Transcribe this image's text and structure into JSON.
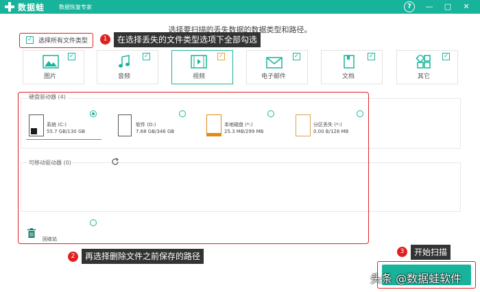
{
  "app": {
    "name": "数据蛙",
    "subtitle": "数据恢复专家",
    "controls": {
      "help": "?",
      "minimize": "—",
      "maximize": "□",
      "close": "✕"
    }
  },
  "colors": {
    "accent": "#17b39a",
    "annotation": "#e02020",
    "callout_bg": "#333333"
  },
  "instruction": "选择要扫描的丢失数据的数据类型和路径。",
  "select_all": {
    "label": "选择所有文件类型",
    "checked": true
  },
  "callouts": [
    {
      "number": "1",
      "text": "在选择丢失的文件类型选项下全部勾选"
    },
    {
      "number": "2",
      "text": "再选择删除文件之前保存的路径"
    },
    {
      "number": "3",
      "text": "开始扫描"
    }
  ],
  "file_types": [
    {
      "label": "图片",
      "icon": "image-icon",
      "checked": true
    },
    {
      "label": "音频",
      "icon": "music-icon",
      "checked": true
    },
    {
      "label": "视频",
      "icon": "video-icon",
      "checked": true,
      "selected": true
    },
    {
      "label": "电子邮件",
      "icon": "mail-icon",
      "checked": true
    },
    {
      "label": "文档",
      "icon": "document-icon",
      "checked": true
    },
    {
      "label": "其它",
      "icon": "other-icon",
      "checked": true
    }
  ],
  "hard_drives": {
    "title": "硬盘驱动器 (4)",
    "drives": [
      {
        "name": "系统 (C:)",
        "usage": "55.7 GB/130 GB",
        "selected": true,
        "icon": "windows-drive-icon"
      },
      {
        "name": "软件 (D:)",
        "usage": "7.68 GB/346 GB",
        "selected": false,
        "icon": "drive-icon"
      },
      {
        "name": "本地磁盘 (*:)",
        "usage": "25.3 MB/299 MB",
        "selected": false,
        "icon": "drive-orange-icon"
      },
      {
        "name": "分区丢失 (*:)",
        "usage": "0.00  B/128 MB",
        "selected": false,
        "icon": "drive-lost-icon"
      }
    ]
  },
  "removable": {
    "title": "可移动驱动器 (0)"
  },
  "recycle_bin": {
    "label": "回收站",
    "selected": false
  },
  "watermark": "头条 @数据蛙软件"
}
